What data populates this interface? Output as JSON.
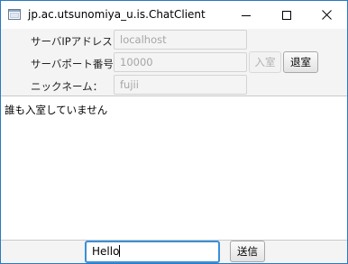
{
  "window": {
    "title": "jp.ac.utsunomiya_u.is.ChatClient"
  },
  "form": {
    "server_ip_label": "サーバIPアドレス：",
    "server_ip_value": "localhost",
    "server_port_label": "サーバポート番号：",
    "server_port_value": "10000",
    "nickname_label": "ニックネーム：",
    "nickname_value": "fujii",
    "enter_button": "入室",
    "leave_button": "退室"
  },
  "log": {
    "text": "誰も入室していません"
  },
  "message": {
    "input_value": "Hello",
    "send_button": "送信"
  },
  "colors": {
    "focus": "#3b8fd7",
    "disabled_text": "#a6a6a6"
  }
}
